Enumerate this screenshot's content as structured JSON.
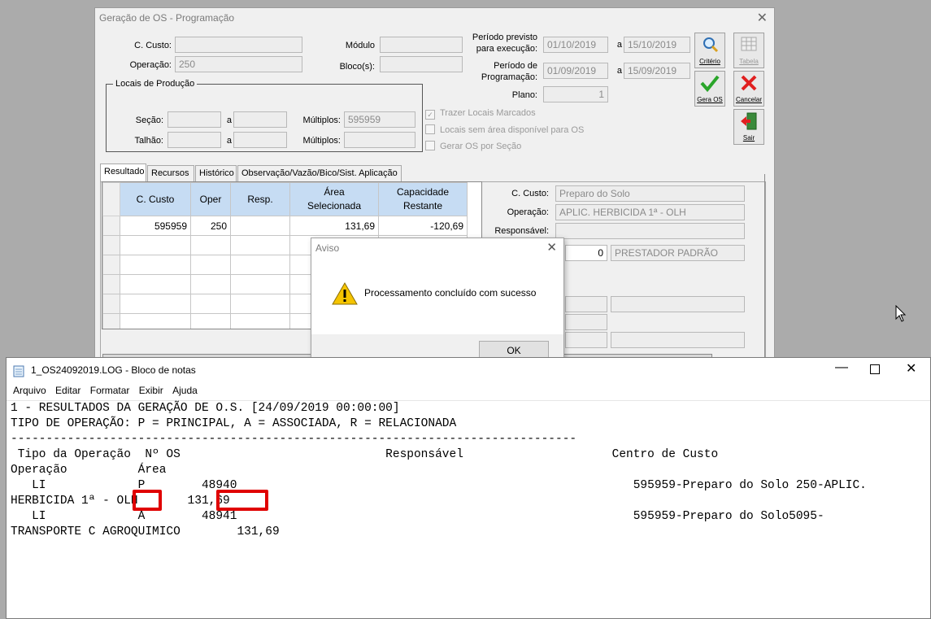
{
  "main_window": {
    "title": "Geração de OS - Programação",
    "labels": {
      "c_custo": "C. Custo:",
      "operacao": "Operação:",
      "modulo": "Módulo",
      "blocos": "Bloco(s):",
      "periodo_previsto": "Período previsto\npara execução:",
      "periodo_programacao": "Período de\nProgramação:",
      "a": "a",
      "plano": "Plano:",
      "locais_producao": "Locais de Produção",
      "secao": "Seção:",
      "talhao": "Talhão:",
      "multiplos": "Múltiplos:"
    },
    "fields": {
      "c_custo": "",
      "operacao": "250",
      "modulo": "",
      "blocos": "",
      "periodo_previsto_de": "01/10/2019",
      "periodo_previsto_ate": "15/10/2019",
      "periodo_prog_de": "01/09/2019",
      "periodo_prog_ate": "15/09/2019",
      "plano": "1",
      "secao_de": "",
      "secao_ate": "",
      "talhao_de": "",
      "talhao_ate": "",
      "multiplos_1": "595959",
      "multiplos_2": ""
    },
    "buttons": {
      "criterio": "Critério",
      "tabela": "Tabela",
      "gera_os": "Gera OS",
      "cancelar": "Cancelar",
      "sair": "Sair"
    },
    "checkboxes": [
      {
        "label": "Trazer Locais Marcados",
        "checked": true
      },
      {
        "label": "Locais sem área disponível para OS",
        "checked": false
      },
      {
        "label": "Gerar OS por Seção",
        "checked": false
      }
    ],
    "tabs": [
      "Resultado",
      "Recursos",
      "Histórico",
      "Observação/Vazão/Bico/Sist. Aplicação"
    ],
    "grid": {
      "headers": [
        "C. Custo",
        "Oper",
        "Resp.",
        "Área\nSelecionada",
        "Capacidade\nRestante"
      ],
      "rows": [
        [
          "595959",
          "250",
          "",
          "131,69",
          "-120,69"
        ]
      ]
    },
    "detail": {
      "c_custo_label": "C. Custo:",
      "c_custo": "Preparo do Solo",
      "operacao_label": "Operação:",
      "operacao": "APLIC. HERBICIDA 1ª - OLH",
      "responsavel_label": "Responsável:",
      "responsavel": "",
      "prestador_code": "0",
      "prestador_name": "PRESTADOR PADRÃO"
    }
  },
  "dialog": {
    "title": "Aviso",
    "message": "Processamento concluído com sucesso",
    "ok": "OK"
  },
  "notepad": {
    "title": "1_OS24092019.LOG - Bloco de notas",
    "menu": [
      "Arquivo",
      "Editar",
      "Formatar",
      "Exibir",
      "Ajuda"
    ],
    "lines": [
      "1 - RESULTADOS DA GERAÇÃO DE O.S. [24/09/2019 00:00:00]",
      "TIPO DE OPERAÇÃO: P = PRINCIPAL, A = ASSOCIADA, R = RELACIONADA",
      "",
      "--------------------------------------------------------------------------------",
      " Tipo da Operação  Nº OS                             Responsável                     Centro de Custo",
      "Operação          Área",
      "   LI             P        48940                                                        595959-Preparo do Solo 250-APLIC.",
      "HERBICIDA 1ª - OLH       131,69",
      "   LI             A        48941                                                        595959-Preparo do Solo5095-",
      "TRANSPORTE C AGROQUIMICO        131,69"
    ]
  }
}
